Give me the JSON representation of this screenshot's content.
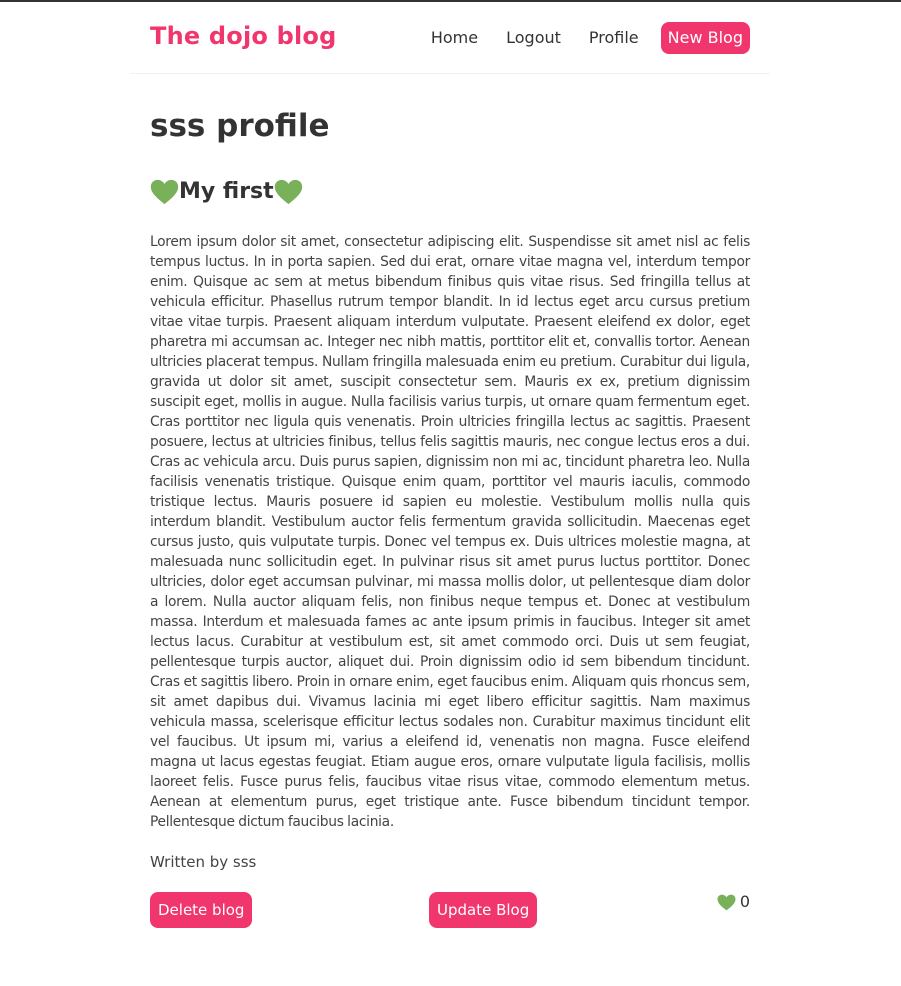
{
  "navbar": {
    "brand": "The dojo blog",
    "links": [
      "Home",
      "Logout",
      "Profile"
    ],
    "new_blog": "New Blog"
  },
  "profile": {
    "title": "sss profile"
  },
  "blog": {
    "title": "My first",
    "body": "Lorem ipsum dolor sit amet, consectetur adipiscing elit. Suspendisse sit amet nisl ac felis tempus luctus. In in porta sapien. Sed dui erat, ornare vitae magna vel, interdum tempor enim. Quisque ac sem at metus bibendum finibus quis vitae risus. Sed fringilla tellus at vehicula efficitur. Phasellus rutrum tempor blandit. In id lectus eget arcu cursus pretium vitae vitae turpis. Praesent aliquam interdum vulputate. Praesent eleifend ex dolor, eget pharetra mi accumsan ac. Integer nec nibh mattis, porttitor elit et, convallis tortor. Aenean ultricies placerat tempus. Nullam fringilla malesuada enim eu pretium. Curabitur dui ligula, gravida ut dolor sit amet, suscipit consectetur sem. Mauris ex ex, pretium dignissim suscipit eget, mollis in augue. Nulla facilisis varius turpis, ut ornare quam fermentum eget. Cras porttitor nec ligula quis venenatis. Proin ultricies fringilla lectus ac sagittis. Praesent posuere, lectus at ultricies finibus, tellus felis sagittis mauris, nec congue lectus eros a dui. Cras ac vehicula arcu. Duis purus sapien, dignissim non mi ac, tincidunt pharetra leo. Nulla facilisis venenatis tristique. Quisque enim quam, porttitor vel mauris iaculis, commodo tristique lectus. Mauris posuere id sapien eu molestie. Vestibulum mollis nulla quis interdum blandit. Vestibulum auctor felis fermentum gravida sollicitudin. Maecenas eget cursus justo, quis vulputate turpis. Donec vel tempus ex. Duis ultrices molestie magna, at malesuada nunc sollicitudin eget. In pulvinar risus sit amet purus luctus porttitor. Donec ultricies, dolor eget accumsan pulvinar, mi massa mollis dolor, ut pellentesque diam dolor a lorem. Nulla auctor aliquam felis, non finibus neque tempus et. Donec at vestibulum massa. Interdum et malesuada fames ac ante ipsum primis in faucibus. Integer sit amet lectus lacus. Curabitur at vestibulum est, sit amet commodo orci. Duis ut sem feugiat, pellentesque turpis auctor, aliquet dui. Proin dignissim odio id sem bibendum tincidunt. Cras et sagittis libero. Proin in ornare enim, eget faucibus enim. Aliquam quis rhoncus sem, sit amet dapibus dui. Vivamus lacinia mi eget libero efficitur sagittis. Nam maximus vehicula massa, scelerisque efficitur lectus sodales non. Curabitur maximus tincidunt elit vel faucibus. Ut ipsum mi, varius a eleifend id, venenatis non magna. Fusce eleifend magna ut lacus egestas feugiat. Etiam augue eros, ornare vulputate ligula facilisis, mollis laoreet felis. Fusce purus felis, faucibus vitae risus vitae, commodo elementum metus. Aenean at elementum purus, eget tristique ante. Fusce bibendum tincidunt tempor. Pellentesque dictum faucibus lacinia.",
    "author": "Written by sss",
    "delete_label": "Delete blog",
    "update_label": "Update Blog",
    "likes": "0"
  },
  "icons": {
    "heart": "green-heart-icon"
  },
  "colors": {
    "accent": "#f1356d",
    "heart": "#78b159",
    "text": "#333333"
  }
}
